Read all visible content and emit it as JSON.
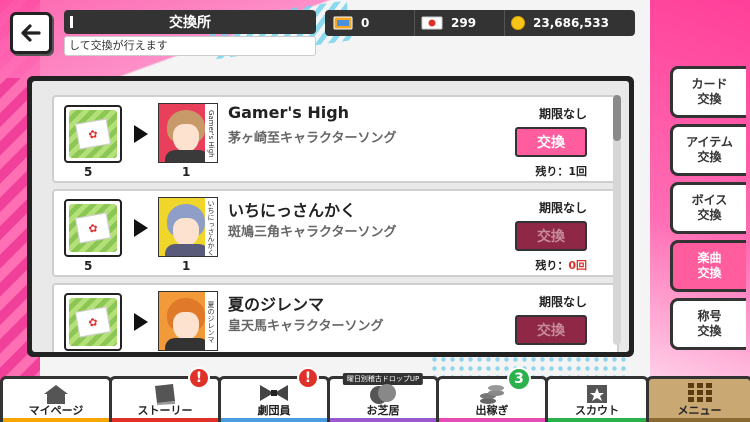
{
  "header": {
    "title": "交換所",
    "subtitle": "して交換が行えます"
  },
  "currency": {
    "ticket_count": "0",
    "voucher_count": "299",
    "coin_count": "23,686,533"
  },
  "items": [
    {
      "cost_qty": "5",
      "reward_qty": "1",
      "title": "Gamer's High",
      "subtitle": "茅ヶ崎至キャラクターソング",
      "jacket_text": "Gamer's High",
      "limit": "期限なし",
      "button": "交換",
      "remain_label": "残り：",
      "remain_value": "1回",
      "hair": "#c89a6a",
      "bg": "#e8405b",
      "body": "#3a3a3a"
    },
    {
      "cost_qty": "5",
      "reward_qty": "1",
      "title": "いちにっさんかく",
      "subtitle": "斑鳩三角キャラクターソング",
      "jacket_text": "いちにっさんかく",
      "limit": "期限なし",
      "button": "交換",
      "remain_label": "残り：",
      "remain_value": "0回",
      "hair": "#8e9ec8",
      "bg": "#f0d62a",
      "body": "#5a5a7a"
    },
    {
      "cost_qty": "",
      "reward_qty": "",
      "title": "夏のジレンマ",
      "subtitle": "皇天馬キャラクターソング",
      "jacket_text": "夏のジレンマ",
      "limit": "期限なし",
      "button": "交換",
      "remain_label": "",
      "remain_value": "",
      "hair": "#e07a2a",
      "bg": "#f29a3a",
      "body": "#333"
    }
  ],
  "side_tabs": [
    {
      "line1": "カード",
      "line2": "交換"
    },
    {
      "line1": "アイテム",
      "line2": "交換"
    },
    {
      "line1": "ボイス",
      "line2": "交換"
    },
    {
      "line1": "楽曲",
      "line2": "交換"
    },
    {
      "line1": "称号",
      "line2": "交換"
    }
  ],
  "nav": {
    "mypage": "マイページ",
    "story": "ストーリー",
    "troupe": "劇団員",
    "play": "お芝居",
    "play_tag": "曜日別稽古ドロップUP",
    "earn": "出稼ぎ",
    "earn_badge": "3",
    "scout": "スカウト",
    "menu": "メニュー",
    "alert": "!"
  },
  "colors": {
    "accent_pink": "#ff5d9d",
    "disabled_button": "#8e2846",
    "alert_red": "#e0302a",
    "badge_green": "#2bb24c"
  }
}
